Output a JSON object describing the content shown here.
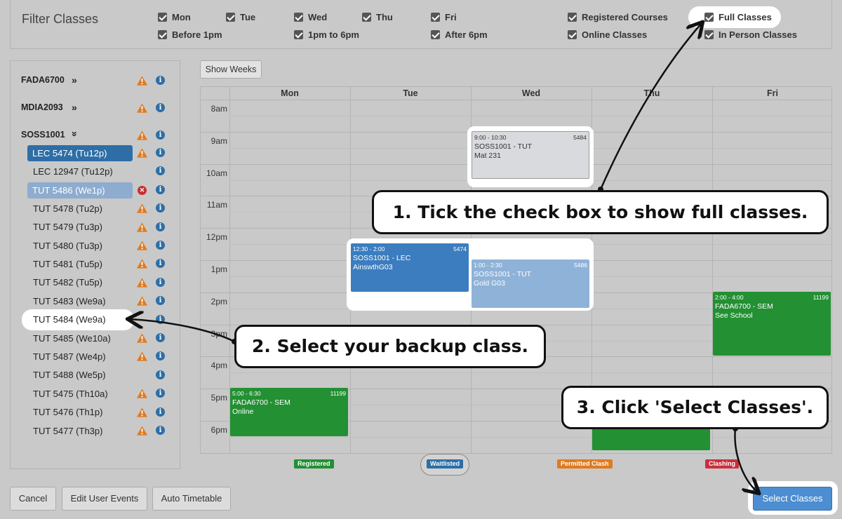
{
  "filter": {
    "title": "Filter Classes",
    "options": [
      {
        "label": "Mon",
        "checked": true
      },
      {
        "label": "Tue",
        "checked": true
      },
      {
        "label": "Wed",
        "checked": true
      },
      {
        "label": "Thu",
        "checked": true
      },
      {
        "label": "Fri",
        "checked": true
      },
      {
        "label": "Registered Courses",
        "checked": true
      },
      {
        "label": "Full Classes",
        "checked": true
      },
      {
        "label": "Before 1pm",
        "checked": true
      },
      {
        "label": "1pm to 6pm",
        "checked": true
      },
      {
        "label": "After 6pm",
        "checked": true
      },
      {
        "label": "Online Classes",
        "checked": true
      },
      {
        "label": "In Person Classes",
        "checked": true
      }
    ]
  },
  "courses": [
    {
      "code": "FADA6700",
      "chevron": "»"
    },
    {
      "code": "MDIA2093",
      "chevron": "»"
    },
    {
      "code": "SOSS1001",
      "chevron": "»"
    }
  ],
  "classes": [
    {
      "label": "LEC 5474 (Tu12p)",
      "state": "selected",
      "icon": "warning"
    },
    {
      "label": "LEC 12947 (Tu12p)",
      "state": "normal",
      "icon": "none"
    },
    {
      "label": "TUT 5486 (We1p)",
      "state": "waitlisted",
      "icon": "error"
    },
    {
      "label": "TUT 5478 (Tu2p)",
      "state": "normal",
      "icon": "warning"
    },
    {
      "label": "TUT 5479 (Tu3p)",
      "state": "normal",
      "icon": "warning"
    },
    {
      "label": "TUT 5480 (Tu3p)",
      "state": "normal",
      "icon": "warning"
    },
    {
      "label": "TUT 5481 (Tu5p)",
      "state": "normal",
      "icon": "warning"
    },
    {
      "label": "TUT 5482 (Tu5p)",
      "state": "normal",
      "icon": "warning"
    },
    {
      "label": "TUT 5483 (We9a)",
      "state": "normal",
      "icon": "warning"
    },
    {
      "label": "TUT 5484 (We9a)",
      "state": "backup",
      "icon": "none"
    },
    {
      "label": "TUT 5485 (We10a)",
      "state": "normal",
      "icon": "warning"
    },
    {
      "label": "TUT 5487 (We4p)",
      "state": "normal",
      "icon": "warning"
    },
    {
      "label": "TUT 5488 (We5p)",
      "state": "normal",
      "icon": "none"
    },
    {
      "label": "TUT 5475 (Th10a)",
      "state": "normal",
      "icon": "warning"
    },
    {
      "label": "TUT 5476 (Th1p)",
      "state": "normal",
      "icon": "warning"
    },
    {
      "label": "TUT 5477 (Th3p)",
      "state": "normal",
      "icon": "warning"
    }
  ],
  "show_weeks_label": "Show Weeks",
  "calendar": {
    "days": [
      "Mon",
      "Tue",
      "Wed",
      "Thu",
      "Fri"
    ],
    "times": [
      "8am",
      "9am",
      "10am",
      "11am",
      "12pm",
      "1pm",
      "2pm",
      "3pm",
      "4pm",
      "5pm",
      "6pm"
    ],
    "events": [
      {
        "time": "9:00 - 10:30",
        "id": "5484",
        "title": "SOSS1001 - TUT",
        "room": "Mat 231",
        "style": "grey"
      },
      {
        "time": "12:30 - 2:00",
        "id": "5474",
        "title": "SOSS1001 - LEC",
        "room": "AinswthG03",
        "style": "blue"
      },
      {
        "time": "1:00 - 2:30",
        "id": "5486",
        "title": "SOSS1001 - TUT",
        "room": "Gold G03",
        "style": "lblue"
      },
      {
        "time": "2:00 - 4:00",
        "id": "11199",
        "title": "FADA6700 - SEM",
        "room": "See School",
        "style": "green"
      },
      {
        "time": "5:00 - 6:30",
        "id": "11199",
        "title": "FADA6700 - SEM",
        "room": "Online",
        "style": "green"
      }
    ]
  },
  "legend": [
    {
      "label": "Registered",
      "color": "#239033"
    },
    {
      "label": "Waitlisted",
      "color": "#2e6ea6"
    },
    {
      "label": "Permitted Clash",
      "color": "#e07a1f"
    },
    {
      "label": "Clashing",
      "color": "#c9303c"
    }
  ],
  "buttons": {
    "cancel": "Cancel",
    "edit_user_events": "Edit User Events",
    "auto_timetable": "Auto Timetable",
    "select_classes": "Select Classes"
  },
  "callouts": {
    "step1": "1. Tick the check box to show full classes.",
    "step2": "2. Select your backup class.",
    "step3": "3. Click 'Select Classes'."
  }
}
